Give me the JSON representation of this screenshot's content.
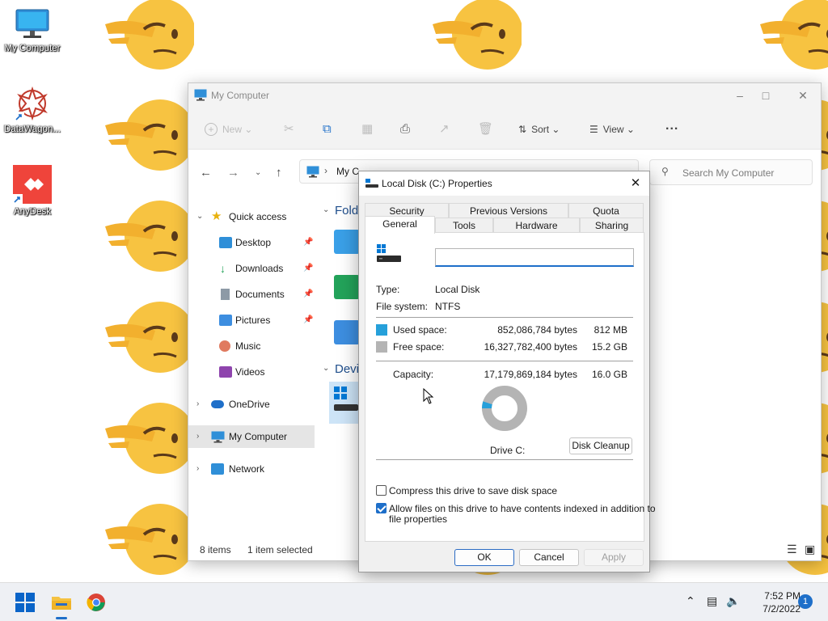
{
  "desktop": {
    "icons": [
      {
        "label": "My Computer"
      },
      {
        "label": "DataWagon..."
      },
      {
        "label": "AnyDesk"
      }
    ]
  },
  "explorer": {
    "title": "My Computer",
    "toolbar": {
      "new_label": "New",
      "sort_label": "Sort",
      "view_label": "View",
      "more_label": "..."
    },
    "address": {
      "path_visible": "My C"
    },
    "search_placeholder": "Search My Computer",
    "sidebar": {
      "quick_access": "Quick access",
      "items": [
        {
          "label": "Desktop"
        },
        {
          "label": "Downloads"
        },
        {
          "label": "Documents"
        },
        {
          "label": "Pictures"
        },
        {
          "label": "Music"
        },
        {
          "label": "Videos"
        }
      ],
      "onedrive": "OneDrive",
      "my_computer": "My Computer",
      "network": "Network"
    },
    "content": {
      "folders_heading": "Fold",
      "devices_heading": "Devi"
    },
    "status": {
      "items": "8 items",
      "selected": "1 item selected"
    }
  },
  "dialog": {
    "title": "Local Disk (C:) Properties",
    "tabs_row1": [
      "Security",
      "Previous Versions",
      "Quota"
    ],
    "tabs_row2": [
      "General",
      "Tools",
      "Hardware",
      "Sharing"
    ],
    "active_tab": "General",
    "name_value": "",
    "type_label": "Type:",
    "type_value": "Local Disk",
    "fs_label": "File system:",
    "fs_value": "NTFS",
    "used_label": "Used space:",
    "used_bytes": "852,086,784 bytes",
    "used_size": "812 MB",
    "free_label": "Free space:",
    "free_bytes": "16,327,782,400 bytes",
    "free_size": "15.2 GB",
    "capacity_label": "Capacity:",
    "capacity_bytes": "17,179,869,184 bytes",
    "capacity_size": "16.0 GB",
    "used_fraction": 0.0496,
    "used_color": "#26a0da",
    "free_color": "#b4b4b4",
    "drive_label": "Drive C:",
    "cleanup_button": "Disk Cleanup",
    "compress_label": "Compress this drive to save disk space",
    "compress_checked": false,
    "index_label_line1": "Allow files on this drive to have contents indexed in addition to",
    "index_label_line2": "file properties",
    "index_checked": true,
    "ok_button": "OK",
    "cancel_button": "Cancel",
    "apply_button": "Apply"
  },
  "taskbar": {
    "time": "7:52 PM",
    "date": "7/2/2022",
    "notification_count": "1"
  }
}
